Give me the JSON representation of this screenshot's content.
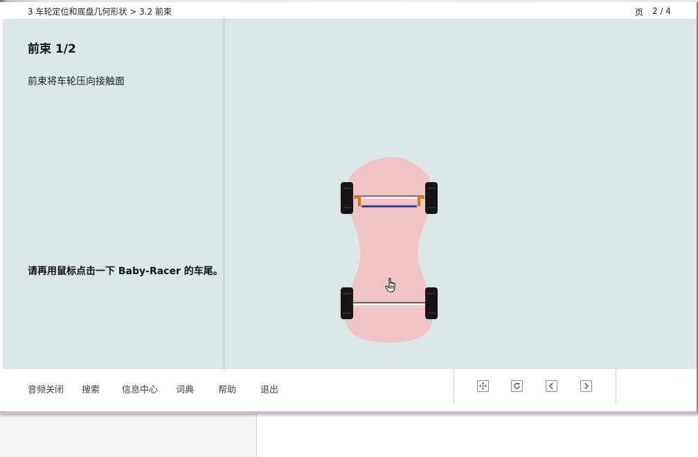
{
  "header": {
    "breadcrumb": "3 车轮定位和底盘几何形状 > 3.2 前束",
    "page_label": "页",
    "page_number": "2 / 4"
  },
  "left_panel": {
    "title": "前束 1/2",
    "description": "前束将车轮压向接触面",
    "instruction": "请再用鼠标点击一下 Baby-Racer 的车尾。"
  },
  "diagram": {
    "car_body_color": "#f1c4c6",
    "tire_color": "#161616",
    "tie_rod_color": "#2e3a8f",
    "steering_arm_color": "#d07a1a",
    "icons": [
      "baby-racer-car-icon",
      "hand-pointer-cursor-icon"
    ]
  },
  "footer": {
    "menu": [
      {
        "label": "音频关闭"
      },
      {
        "label": "搜索"
      },
      {
        "label": "信息中心"
      },
      {
        "label": "词典"
      },
      {
        "label": "帮助"
      },
      {
        "label": "退出"
      }
    ],
    "nav_icons": [
      "move-icon",
      "reload-icon",
      "previous-icon",
      "next-icon"
    ]
  }
}
